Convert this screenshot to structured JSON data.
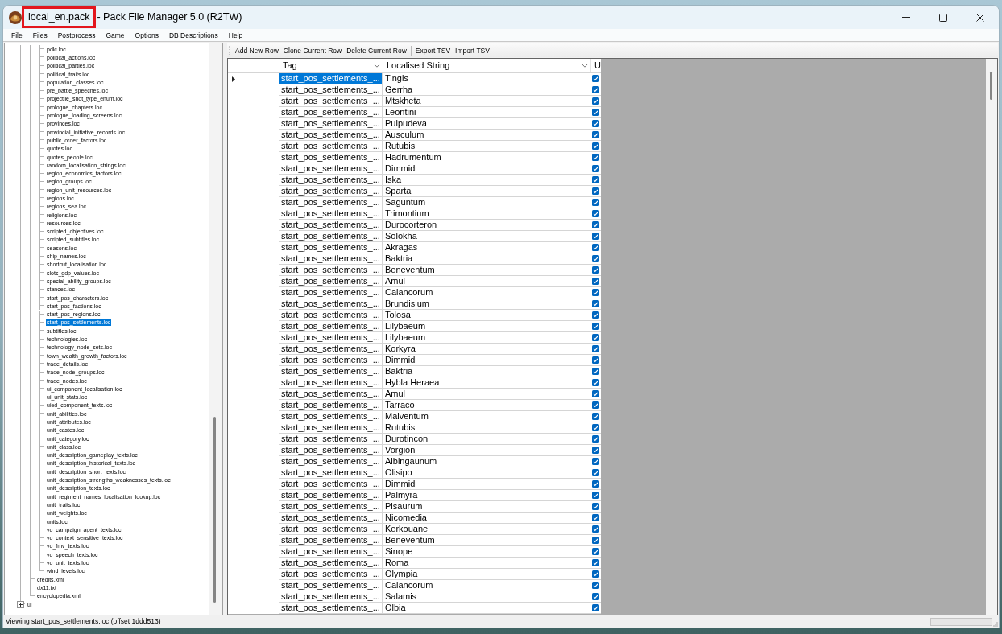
{
  "window": {
    "title_file": "local_en.pack",
    "title_app": "- Pack File Manager 5.0 (R2TW)",
    "file_highlighted": true
  },
  "menu": [
    "File",
    "Files",
    "Postprocess",
    "Game",
    "Options",
    "DB Descriptions",
    "Help"
  ],
  "tree": {
    "items": [
      {
        "children": [
          {
            "children": [
              {
                "label": "pdlc.loc",
                "selected": false
              },
              {
                "label": "political_actions.loc",
                "selected": false
              },
              {
                "label": "political_parties.loc",
                "selected": false
              },
              {
                "label": "political_traits.loc",
                "selected": false
              },
              {
                "label": "population_classes.loc",
                "selected": false
              },
              {
                "label": "pre_battle_speeches.loc",
                "selected": false
              },
              {
                "label": "projectile_shot_type_enum.loc",
                "selected": false
              },
              {
                "label": "prologue_chapters.loc",
                "selected": false
              },
              {
                "label": "prologue_loading_screens.loc",
                "selected": false
              },
              {
                "label": "provinces.loc",
                "selected": false
              },
              {
                "label": "provincial_initiative_records.loc",
                "selected": false
              },
              {
                "label": "public_order_factors.loc",
                "selected": false
              },
              {
                "label": "quotes.loc",
                "selected": false
              },
              {
                "label": "quotes_people.loc",
                "selected": false
              },
              {
                "label": "random_localisation_strings.loc",
                "selected": false
              },
              {
                "label": "region_economics_factors.loc",
                "selected": false
              },
              {
                "label": "region_groups.loc",
                "selected": false
              },
              {
                "label": "region_unit_resources.loc",
                "selected": false
              },
              {
                "label": "regions.loc",
                "selected": false
              },
              {
                "label": "regions_sea.loc",
                "selected": false
              },
              {
                "label": "religions.loc",
                "selected": false
              },
              {
                "label": "resources.loc",
                "selected": false
              },
              {
                "label": "scripted_objectives.loc",
                "selected": false
              },
              {
                "label": "scripted_subtitles.loc",
                "selected": false
              },
              {
                "label": "seasons.loc",
                "selected": false
              },
              {
                "label": "ship_names.loc",
                "selected": false
              },
              {
                "label": "shortcut_localisation.loc",
                "selected": false
              },
              {
                "label": "slots_gdp_values.loc",
                "selected": false
              },
              {
                "label": "special_ability_groups.loc",
                "selected": false
              },
              {
                "label": "stances.loc",
                "selected": false
              },
              {
                "label": "start_pos_characters.loc",
                "selected": false
              },
              {
                "label": "start_pos_factions.loc",
                "selected": false
              },
              {
                "label": "start_pos_regions.loc",
                "selected": false
              },
              {
                "label": "start_pos_settlements.loc",
                "selected": true
              },
              {
                "label": "subtitles.loc",
                "selected": false
              },
              {
                "label": "technologies.loc",
                "selected": false
              },
              {
                "label": "technology_node_sets.loc",
                "selected": false
              },
              {
                "label": "town_wealth_growth_factors.loc",
                "selected": false
              },
              {
                "label": "trade_details.loc",
                "selected": false
              },
              {
                "label": "trade_node_groups.loc",
                "selected": false
              },
              {
                "label": "trade_nodes.loc",
                "selected": false
              },
              {
                "label": "ui_component_localisation.loc",
                "selected": false
              },
              {
                "label": "ui_unit_stats.loc",
                "selected": false
              },
              {
                "label": "uied_component_texts.loc",
                "selected": false
              },
              {
                "label": "unit_abilities.loc",
                "selected": false
              },
              {
                "label": "unit_attributes.loc",
                "selected": false
              },
              {
                "label": "unit_castes.loc",
                "selected": false
              },
              {
                "label": "unit_category.loc",
                "selected": false
              },
              {
                "label": "unit_class.loc",
                "selected": false
              },
              {
                "label": "unit_description_gameplay_texts.loc",
                "selected": false
              },
              {
                "label": "unit_description_historical_texts.loc",
                "selected": false
              },
              {
                "label": "unit_description_short_texts.loc",
                "selected": false
              },
              {
                "label": "unit_description_strengths_weaknesses_texts.loc",
                "selected": false
              },
              {
                "label": "unit_description_texts.loc",
                "selected": false
              },
              {
                "label": "unit_regiment_names_localisation_lookup.loc",
                "selected": false
              },
              {
                "label": "unit_traits.loc",
                "selected": false
              },
              {
                "label": "unit_weights.loc",
                "selected": false
              },
              {
                "label": "units.loc",
                "selected": false
              },
              {
                "label": "vo_campaign_agent_texts.loc",
                "selected": false
              },
              {
                "label": "vo_context_sensitive_texts.loc",
                "selected": false
              },
              {
                "label": "vo_fmv_texts.loc",
                "selected": false
              },
              {
                "label": "vo_speech_texts.loc",
                "selected": false
              },
              {
                "label": "vo_unit_texts.loc",
                "selected": false
              },
              {
                "label": "wind_levels.loc",
                "selected": false
              }
            ]
          },
          {
            "label": "credits.xml",
            "selected": false
          },
          {
            "label": "dx11.txt",
            "selected": false
          },
          {
            "label": "encyclopedia.xml",
            "selected": false
          }
        ]
      },
      {
        "label": "ui",
        "selected": false,
        "expanded": false
      }
    ]
  },
  "toolbar": {
    "groups": [
      [
        "Add New Row",
        "Clone Current Row",
        "Delete Current Row"
      ],
      [
        "Export TSV",
        "Import TSV"
      ]
    ]
  },
  "table": {
    "columns": [
      {
        "label": "Tag",
        "filter": true
      },
      {
        "label": "Localised String",
        "filter": true
      },
      {
        "label": "U",
        "filter": false
      }
    ],
    "rows": [
      {
        "tag": "start_pos_settlements_...",
        "string": "Tingis",
        "checked": true,
        "current": true,
        "selected": true
      },
      {
        "tag": "start_pos_settlements_...",
        "string": "Gerrha",
        "checked": true,
        "current": false,
        "selected": false
      },
      {
        "tag": "start_pos_settlements_...",
        "string": "Mtskheta",
        "checked": true,
        "current": false,
        "selected": false
      },
      {
        "tag": "start_pos_settlements_...",
        "string": "Leontini",
        "checked": true,
        "current": false,
        "selected": false
      },
      {
        "tag": "start_pos_settlements_...",
        "string": "Pulpudeva",
        "checked": true,
        "current": false,
        "selected": false
      },
      {
        "tag": "start_pos_settlements_...",
        "string": "Ausculum",
        "checked": true,
        "current": false,
        "selected": false
      },
      {
        "tag": "start_pos_settlements_...",
        "string": "Rutubis",
        "checked": true,
        "current": false,
        "selected": false
      },
      {
        "tag": "start_pos_settlements_...",
        "string": "Hadrumentum",
        "checked": true,
        "current": false,
        "selected": false
      },
      {
        "tag": "start_pos_settlements_...",
        "string": "Dimmidi",
        "checked": true,
        "current": false,
        "selected": false
      },
      {
        "tag": "start_pos_settlements_...",
        "string": "Iska",
        "checked": true,
        "current": false,
        "selected": false
      },
      {
        "tag": "start_pos_settlements_...",
        "string": "Sparta",
        "checked": true,
        "current": false,
        "selected": false
      },
      {
        "tag": "start_pos_settlements_...",
        "string": "Saguntum",
        "checked": true,
        "current": false,
        "selected": false
      },
      {
        "tag": "start_pos_settlements_...",
        "string": "Trimontium",
        "checked": true,
        "current": false,
        "selected": false
      },
      {
        "tag": "start_pos_settlements_...",
        "string": "Durocorteron",
        "checked": true,
        "current": false,
        "selected": false
      },
      {
        "tag": "start_pos_settlements_...",
        "string": "Solokha",
        "checked": true,
        "current": false,
        "selected": false
      },
      {
        "tag": "start_pos_settlements_...",
        "string": "Akragas",
        "checked": true,
        "current": false,
        "selected": false
      },
      {
        "tag": "start_pos_settlements_...",
        "string": "Baktria",
        "checked": true,
        "current": false,
        "selected": false
      },
      {
        "tag": "start_pos_settlements_...",
        "string": "Beneventum",
        "checked": true,
        "current": false,
        "selected": false
      },
      {
        "tag": "start_pos_settlements_...",
        "string": "Amul",
        "checked": true,
        "current": false,
        "selected": false
      },
      {
        "tag": "start_pos_settlements_...",
        "string": "Calancorum",
        "checked": true,
        "current": false,
        "selected": false
      },
      {
        "tag": "start_pos_settlements_...",
        "string": "Brundisium",
        "checked": true,
        "current": false,
        "selected": false
      },
      {
        "tag": "start_pos_settlements_...",
        "string": "Tolosa",
        "checked": true,
        "current": false,
        "selected": false
      },
      {
        "tag": "start_pos_settlements_...",
        "string": "Lilybaeum",
        "checked": true,
        "current": false,
        "selected": false
      },
      {
        "tag": "start_pos_settlements_...",
        "string": "Lilybaeum",
        "checked": true,
        "current": false,
        "selected": false
      },
      {
        "tag": "start_pos_settlements_...",
        "string": "Korkyra",
        "checked": true,
        "current": false,
        "selected": false
      },
      {
        "tag": "start_pos_settlements_...",
        "string": "Dimmidi",
        "checked": true,
        "current": false,
        "selected": false
      },
      {
        "tag": "start_pos_settlements_...",
        "string": "Baktria",
        "checked": true,
        "current": false,
        "selected": false
      },
      {
        "tag": "start_pos_settlements_...",
        "string": "Hybla Heraea",
        "checked": true,
        "current": false,
        "selected": false
      },
      {
        "tag": "start_pos_settlements_...",
        "string": "Amul",
        "checked": true,
        "current": false,
        "selected": false
      },
      {
        "tag": "start_pos_settlements_...",
        "string": "Tarraco",
        "checked": true,
        "current": false,
        "selected": false
      },
      {
        "tag": "start_pos_settlements_...",
        "string": "Malventum",
        "checked": true,
        "current": false,
        "selected": false
      },
      {
        "tag": "start_pos_settlements_...",
        "string": "Rutubis",
        "checked": true,
        "current": false,
        "selected": false
      },
      {
        "tag": "start_pos_settlements_...",
        "string": "Durotincon",
        "checked": true,
        "current": false,
        "selected": false
      },
      {
        "tag": "start_pos_settlements_...",
        "string": "Vorgion",
        "checked": true,
        "current": false,
        "selected": false
      },
      {
        "tag": "start_pos_settlements_...",
        "string": "Albingaunum",
        "checked": true,
        "current": false,
        "selected": false
      },
      {
        "tag": "start_pos_settlements_...",
        "string": "Olisipo",
        "checked": true,
        "current": false,
        "selected": false
      },
      {
        "tag": "start_pos_settlements_...",
        "string": "Dimmidi",
        "checked": true,
        "current": false,
        "selected": false
      },
      {
        "tag": "start_pos_settlements_...",
        "string": "Palmyra",
        "checked": true,
        "current": false,
        "selected": false
      },
      {
        "tag": "start_pos_settlements_...",
        "string": "Pisaurum",
        "checked": true,
        "current": false,
        "selected": false
      },
      {
        "tag": "start_pos_settlements_...",
        "string": "Nicomedia",
        "checked": true,
        "current": false,
        "selected": false
      },
      {
        "tag": "start_pos_settlements_...",
        "string": "Kerkouane",
        "checked": true,
        "current": false,
        "selected": false
      },
      {
        "tag": "start_pos_settlements_...",
        "string": "Beneventum",
        "checked": true,
        "current": false,
        "selected": false
      },
      {
        "tag": "start_pos_settlements_...",
        "string": "Sinope",
        "checked": true,
        "current": false,
        "selected": false
      },
      {
        "tag": "start_pos_settlements_...",
        "string": "Roma",
        "checked": true,
        "current": false,
        "selected": false
      },
      {
        "tag": "start_pos_settlements_...",
        "string": "Olympia",
        "checked": true,
        "current": false,
        "selected": false
      },
      {
        "tag": "start_pos_settlements_...",
        "string": "Calancorum",
        "checked": true,
        "current": false,
        "selected": false
      },
      {
        "tag": "start_pos_settlements_...",
        "string": "Salamis",
        "checked": true,
        "current": false,
        "selected": false
      },
      {
        "tag": "start_pos_settlements_...",
        "string": "Olbia",
        "checked": true,
        "current": false,
        "selected": false
      }
    ]
  },
  "status_bar": {
    "text": "Viewing start_pos_settlements.loc (offset 1ddd513)",
    "progress": {
      "level": 0
    }
  }
}
